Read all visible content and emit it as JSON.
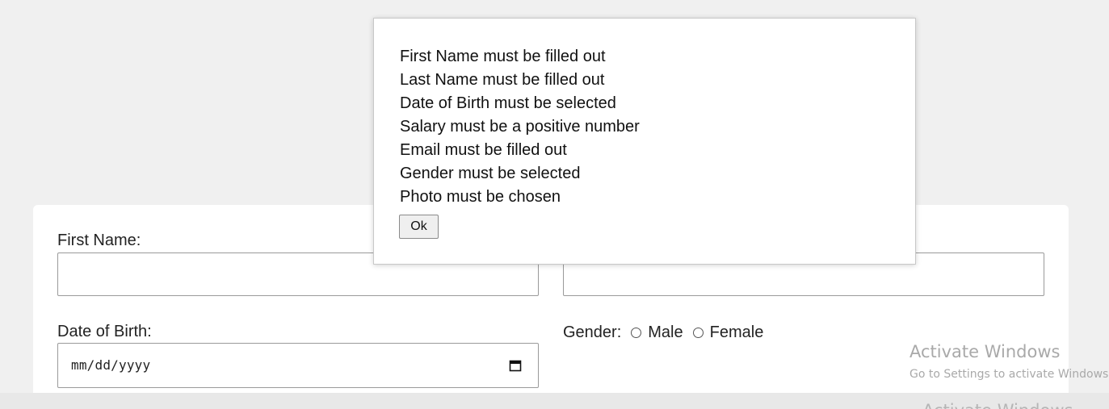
{
  "form": {
    "first_name_label": "First Name:",
    "first_name_value": "",
    "last_name_value": "",
    "dob_label": "Date of Birth:",
    "dob_placeholder": "mm/dd/yyyy",
    "gender_label": "Gender:",
    "gender_options": [
      "Male",
      "Female"
    ]
  },
  "alert": {
    "messages": [
      "First Name must be filled out",
      "Last Name must be filled out",
      "Date of Birth must be selected",
      "Salary must be a positive number",
      "Email must be filled out",
      "Gender must be selected",
      "Photo must be chosen"
    ],
    "ok_label": "Ok"
  },
  "watermark": {
    "title": "Activate Windows",
    "subtitle": "Go to Settings to activate Windows.",
    "ghost": "Activate Windows"
  },
  "icons": {
    "calendar": "calendar-icon",
    "radio": "radio-circle"
  }
}
